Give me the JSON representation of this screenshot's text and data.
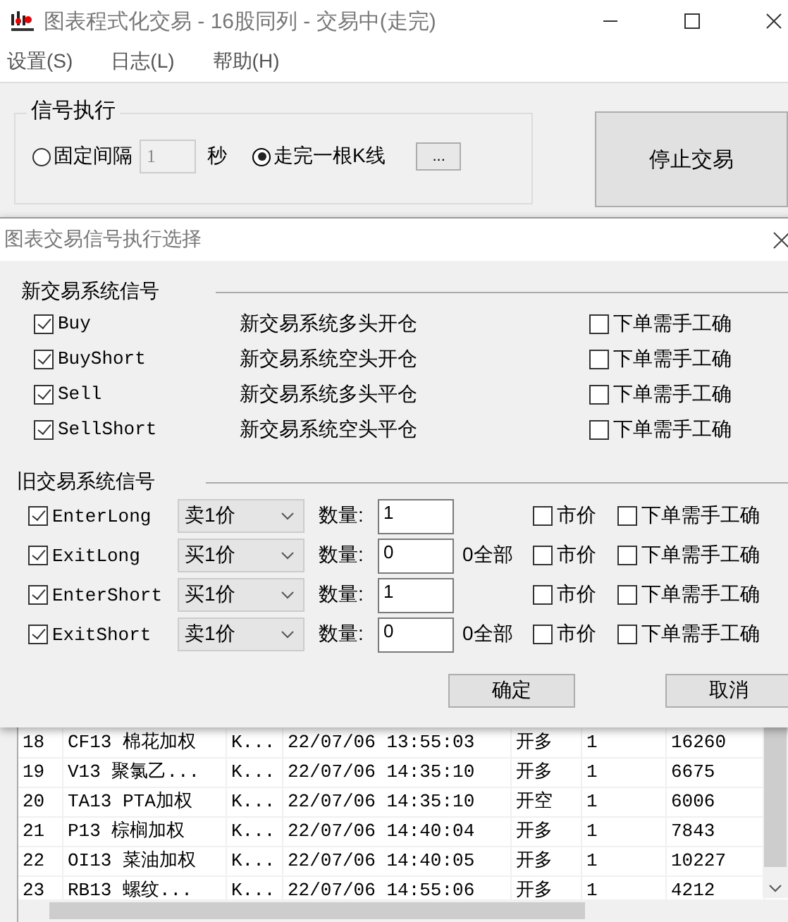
{
  "window": {
    "title": "图表程式化交易 - 16股同列 - 交易中(走完)"
  },
  "menu": [
    "设置(S)",
    "日志(L)",
    "帮助(H)"
  ],
  "signal_execution": {
    "title": "信号执行",
    "options": [
      {
        "label": "固定间隔",
        "selected": false
      },
      {
        "label": "走完一根K线",
        "selected": true
      }
    ],
    "interval": {
      "value": "1",
      "unit": "秒",
      "disabled": true
    },
    "more_button": "...",
    "stop_button": "停止交易"
  },
  "dialog": {
    "title": "图表交易信号执行选择",
    "new_section": {
      "title": "新交易系统信号",
      "rows": [
        {
          "name": "Buy",
          "checked": true,
          "description": "新交易系统多头开仓",
          "confirm": {
            "label": "下单需手工确",
            "checked": false
          }
        },
        {
          "name": "BuyShort",
          "checked": true,
          "description": "新交易系统空头开仓",
          "confirm": {
            "label": "下单需手工确",
            "checked": false
          }
        },
        {
          "name": "Sell",
          "checked": true,
          "description": "新交易系统多头平仓",
          "confirm": {
            "label": "下单需手工确",
            "checked": false
          }
        },
        {
          "name": "SellShort",
          "checked": true,
          "description": "新交易系统空头平仓",
          "confirm": {
            "label": "下单需手工确",
            "checked": false
          }
        }
      ]
    },
    "old_section": {
      "title": "旧交易系统信号",
      "rows": [
        {
          "name": "EnterLong",
          "checked": true,
          "price": "卖1价",
          "qty_label": "数量:",
          "qty": "1",
          "market": {
            "label": "市价",
            "checked": false
          },
          "confirm": {
            "label": "下单需手工确",
            "checked": false
          }
        },
        {
          "name": "ExitLong",
          "checked": true,
          "price": "买1价",
          "qty_label": "数量:",
          "qty": "0",
          "hint": "0全部",
          "market": {
            "label": "市价",
            "checked": false
          },
          "confirm": {
            "label": "下单需手工确",
            "checked": false
          }
        },
        {
          "name": "EnterShort",
          "checked": true,
          "price": "买1价",
          "qty_label": "数量:",
          "qty": "1",
          "market": {
            "label": "市价",
            "checked": false
          },
          "confirm": {
            "label": "下单需手工确",
            "checked": false
          }
        },
        {
          "name": "ExitShort",
          "checked": true,
          "price": "卖1价",
          "qty_label": "数量:",
          "qty": "0",
          "hint": "0全部",
          "market": {
            "label": "市价",
            "checked": false
          },
          "confirm": {
            "label": "下单需手工确",
            "checked": false
          }
        }
      ]
    },
    "buttons": [
      "确定",
      "取消"
    ]
  },
  "table": {
    "rows": [
      [
        "18",
        "CF13 棉花加权",
        "K...",
        "22/07/06 13:55:03",
        "开多",
        "1",
        "16260"
      ],
      [
        "19",
        "V13 聚氯乙...",
        "K...",
        "22/07/06 14:35:10",
        "开多",
        "1",
        "6675"
      ],
      [
        "20",
        "TA13 PTA加权",
        "K...",
        "22/07/06 14:35:10",
        "开空",
        "1",
        "6006"
      ],
      [
        "21",
        "P13 棕榈加权",
        "K...",
        "22/07/06 14:40:04",
        "开多",
        "1",
        "7843"
      ],
      [
        "22",
        "OI13 菜油加权",
        "K...",
        "22/07/06 14:40:05",
        "开多",
        "1",
        "10227"
      ],
      [
        "23",
        "RB13 螺纹...",
        "K...",
        "22/07/06 14:55:06",
        "开多",
        "1",
        "4212"
      ]
    ]
  }
}
